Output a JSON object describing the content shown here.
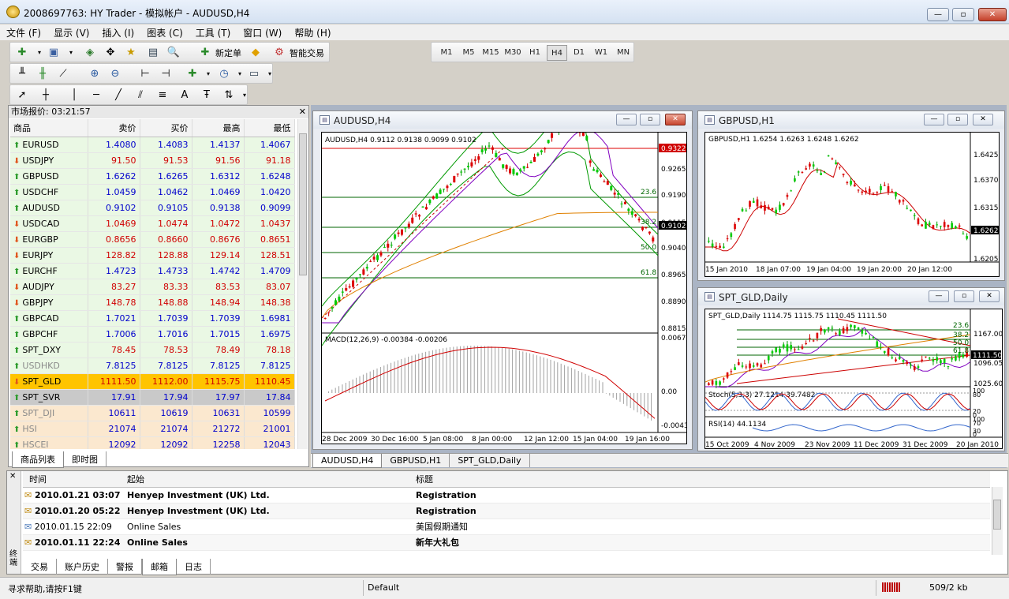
{
  "window": {
    "title": "2008697763: HY Trader - 模拟帐户 - AUDUSD,H4",
    "min": "—",
    "max": "▫",
    "close": "✕"
  },
  "menu": [
    "文件 (F)",
    "显示 (V)",
    "插入 (I)",
    "图表 (C)",
    "工具 (T)",
    "窗口 (W)",
    "帮助 (H)"
  ],
  "toolbar": {
    "new_order": "新定单",
    "expert": "智能交易",
    "timeframes": [
      "M1",
      "M5",
      "M15",
      "M30",
      "H1",
      "H4",
      "D1",
      "W1",
      "MN"
    ],
    "active_tf": "H4",
    "text_tool": "A"
  },
  "market_watch": {
    "header": "市场报价: 03:21:57",
    "columns": [
      "商品",
      "卖价",
      "买价",
      "最高",
      "最低"
    ],
    "rows": [
      {
        "sym": "EURUSD",
        "dir": "up",
        "bid": "1.4080",
        "ask": "1.4083",
        "high": "1.4137",
        "low": "1.4067",
        "bg": "#eaf8e4",
        "color": "#0000cc"
      },
      {
        "sym": "USDJPY",
        "dir": "down",
        "bid": "91.50",
        "ask": "91.53",
        "high": "91.56",
        "low": "91.18",
        "bg": "#eaf8e4",
        "color": "#d00000"
      },
      {
        "sym": "GBPUSD",
        "dir": "up",
        "bid": "1.6262",
        "ask": "1.6265",
        "high": "1.6312",
        "low": "1.6248",
        "bg": "#eaf8e4",
        "color": "#0000cc"
      },
      {
        "sym": "USDCHF",
        "dir": "up",
        "bid": "1.0459",
        "ask": "1.0462",
        "high": "1.0469",
        "low": "1.0420",
        "bg": "#eaf8e4",
        "color": "#0000cc"
      },
      {
        "sym": "AUDUSD",
        "dir": "up",
        "bid": "0.9102",
        "ask": "0.9105",
        "high": "0.9138",
        "low": "0.9099",
        "bg": "#eaf8e4",
        "color": "#0000cc"
      },
      {
        "sym": "USDCAD",
        "dir": "down",
        "bid": "1.0469",
        "ask": "1.0474",
        "high": "1.0472",
        "low": "1.0437",
        "bg": "#eaf8e4",
        "color": "#d00000"
      },
      {
        "sym": "EURGBP",
        "dir": "down",
        "bid": "0.8656",
        "ask": "0.8660",
        "high": "0.8676",
        "low": "0.8651",
        "bg": "#eaf8e4",
        "color": "#d00000"
      },
      {
        "sym": "EURJPY",
        "dir": "down",
        "bid": "128.82",
        "ask": "128.88",
        "high": "129.14",
        "low": "128.51",
        "bg": "#eaf8e4",
        "color": "#d00000"
      },
      {
        "sym": "EURCHF",
        "dir": "up",
        "bid": "1.4723",
        "ask": "1.4733",
        "high": "1.4742",
        "low": "1.4709",
        "bg": "#eaf8e4",
        "color": "#0000cc"
      },
      {
        "sym": "AUDJPY",
        "dir": "down",
        "bid": "83.27",
        "ask": "83.33",
        "high": "83.53",
        "low": "83.07",
        "bg": "#eaf8e4",
        "color": "#d00000"
      },
      {
        "sym": "GBPJPY",
        "dir": "down",
        "bid": "148.78",
        "ask": "148.88",
        "high": "148.94",
        "low": "148.38",
        "bg": "#eaf8e4",
        "color": "#d00000"
      },
      {
        "sym": "GBPCAD",
        "dir": "up",
        "bid": "1.7021",
        "ask": "1.7039",
        "high": "1.7039",
        "low": "1.6981",
        "bg": "#eaf8e4",
        "color": "#0000cc"
      },
      {
        "sym": "GBPCHF",
        "dir": "up",
        "bid": "1.7006",
        "ask": "1.7016",
        "high": "1.7015",
        "low": "1.6975",
        "bg": "#eaf8e4",
        "color": "#0000cc"
      },
      {
        "sym": "SPT_DXY",
        "dir": "up",
        "bid": "78.45",
        "ask": "78.53",
        "high": "78.49",
        "low": "78.18",
        "bg": "#eaf8e4",
        "color": "#d00000"
      },
      {
        "sym": "USDHKD",
        "dir": "up",
        "bid": "7.8125",
        "ask": "7.8125",
        "high": "7.8125",
        "low": "7.8125",
        "bg": "#eaf8e4",
        "color": "#0000cc",
        "symgray": true
      },
      {
        "sym": "SPT_GLD",
        "dir": "down",
        "bid": "1111.50",
        "ask": "1112.00",
        "high": "1115.75",
        "low": "1110.45",
        "bg": "#ffc400",
        "color": "#d00000"
      },
      {
        "sym": "SPT_SVR",
        "dir": "up",
        "bid": "17.91",
        "ask": "17.94",
        "high": "17.97",
        "low": "17.84",
        "bg": "#c9c9c9",
        "color": "#0000cc"
      },
      {
        "sym": "SPT_DJI",
        "dir": "up",
        "bid": "10611",
        "ask": "10619",
        "high": "10631",
        "low": "10599",
        "bg": "#fbe8cf",
        "color": "#0000cc",
        "symgray": true
      },
      {
        "sym": "HSI",
        "dir": "up",
        "bid": "21074",
        "ask": "21074",
        "high": "21272",
        "low": "21001",
        "bg": "#fbe8cf",
        "color": "#0000cc",
        "symgray": true
      },
      {
        "sym": "HSCEI",
        "dir": "up",
        "bid": "12092",
        "ask": "12092",
        "high": "12258",
        "low": "12043",
        "bg": "#fbe8cf",
        "color": "#0000cc",
        "symgray": true
      }
    ],
    "tabs": [
      "商品列表",
      "即时图"
    ]
  },
  "charts": {
    "audusd": {
      "title": "AUDUSD,H4",
      "info": "AUDUSD,H4  0.9112 0.9138 0.9099 0.9102",
      "macd_label": "MACD(12,26,9) -0.00384 -0.00206",
      "prices": [
        "0.9322",
        "0.9265",
        "0.9190",
        "0.9115",
        "0.9102",
        "0.9040",
        "0.8965",
        "0.8890",
        "0.8815"
      ],
      "red_price": "0.9322",
      "cur_price": "0.9102",
      "fib": [
        "23.6",
        "38.2",
        "50.0",
        "61.8"
      ],
      "macd_prices": [
        "0.00672",
        "0.00",
        "-0.00434"
      ],
      "dates": [
        "28 Dec 2009",
        "30 Dec 16:00",
        "5 Jan 08:00",
        "8 Jan 00:00",
        "12 Jan 12:00",
        "15 Jan 04:00",
        "19 Jan 16:00"
      ]
    },
    "gbpusd": {
      "title": "GBPUSD,H1",
      "info": "GBPUSD,H1  1.6254 1.6263 1.6248 1.6262",
      "prices": [
        "1.6425",
        "1.6370",
        "1.6315",
        "1.6262",
        "1.6205"
      ],
      "cur_price": "1.6262",
      "dates": [
        "15 Jan 2010",
        "18 Jan 07:00",
        "19 Jan 04:00",
        "19 Jan 20:00",
        "20 Jan 12:00"
      ]
    },
    "gld": {
      "title": "SPT_GLD,Daily",
      "info": "SPT_GLD,Daily  1114.75 1115.75 1110.45 1111.50",
      "prices": [
        "1167.00",
        "1111.50",
        "1096.05",
        "1025.60"
      ],
      "cur_price": "1111.50",
      "fib": [
        "23.6",
        "38.2",
        "50.0",
        "61.8"
      ],
      "stoch": "Stoch(5,3,3) 27.1214 39.7482",
      "stoch_levels": [
        "100",
        "80",
        "20",
        "0"
      ],
      "rsi": "RSI(14) 44.1134",
      "rsi_levels": [
        "100",
        "70",
        "30",
        "0"
      ],
      "dates": [
        "15 Oct 2009",
        "4 Nov 2009",
        "23 Nov 2009",
        "11 Dec 2009",
        "31 Dec 2009",
        "20 Jan 2010"
      ]
    }
  },
  "chart_tabs": [
    "AUDUSD,H4",
    "GBPUSD,H1",
    "SPT_GLD,Daily"
  ],
  "terminal": {
    "columns": [
      "时间",
      "起始",
      "标题"
    ],
    "rows": [
      {
        "time": "2010.01.21 03:07",
        "from": "Henyep Investment (UK) Ltd.",
        "subject": "Registration",
        "bold": true,
        "icon": "mail-closed"
      },
      {
        "time": "2010.01.20 05:22",
        "from": "Henyep Investment (UK) Ltd.",
        "subject": "Registration",
        "bold": true,
        "icon": "mail-closed"
      },
      {
        "time": "2010.01.15 22:09",
        "from": "Online Sales",
        "subject": "美国假期通知",
        "bold": false,
        "icon": "mail-open"
      },
      {
        "time": "2010.01.11 22:24",
        "from": "Online Sales",
        "subject": "新年大礼包",
        "bold": true,
        "icon": "mail-closed"
      }
    ],
    "tabs": [
      "交易",
      "账户历史",
      "警报",
      "邮箱",
      "日志"
    ],
    "active_tab": "邮箱",
    "side_label": "终端"
  },
  "statusbar": {
    "help": "寻求帮助,请按F1键",
    "profile": "Default",
    "traffic": "509/2 kb"
  }
}
